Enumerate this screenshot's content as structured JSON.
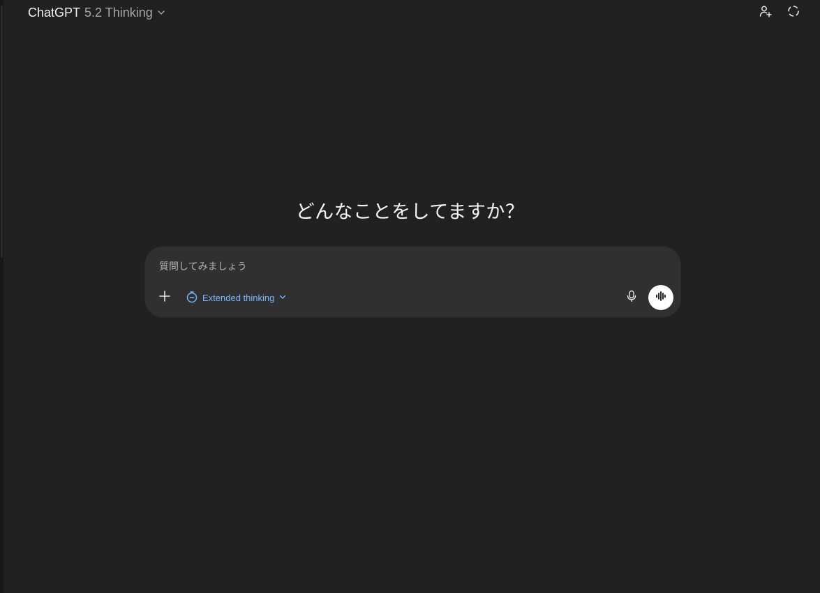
{
  "header": {
    "brand": "ChatGPT",
    "model": "5.2 Thinking",
    "model_chevron_icon": "chevron-down-icon",
    "actions": [
      {
        "name": "add-people-icon"
      },
      {
        "name": "temporary-chat-icon"
      }
    ]
  },
  "main": {
    "greeting": "どんなことをしてますか？"
  },
  "composer": {
    "placeholder": "質問してみましょう",
    "value": "",
    "plus_icon": "plus-icon",
    "thinking_label": "Extended thinking",
    "thinking_icon": "stopwatch-icon",
    "thinking_color": "#7ab7ff",
    "mic_icon": "microphone-icon",
    "voice_icon": "voice-waveform-icon"
  },
  "colors": {
    "background": "#212121",
    "composer_bg": "#303030",
    "accent": "#7ab7ff",
    "voice_button": "#ffffff"
  }
}
